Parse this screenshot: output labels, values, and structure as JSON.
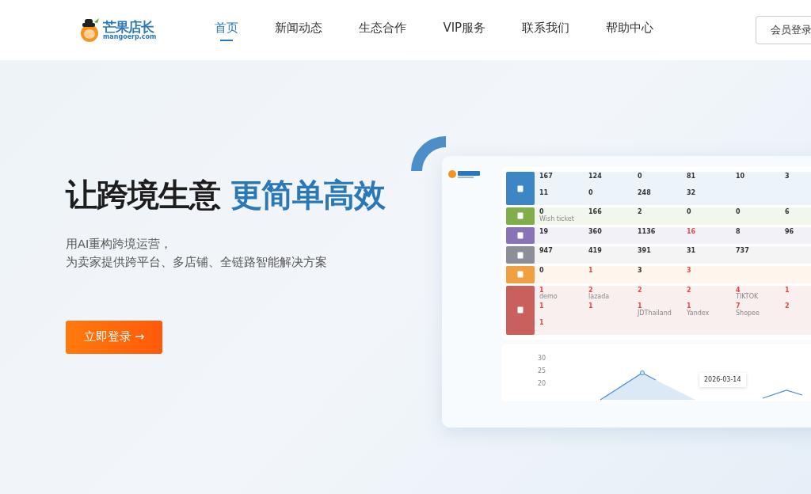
{
  "nav": {
    "logo": {
      "name": "芒果店长",
      "domain": "mangoerp.com"
    },
    "items": [
      {
        "label": "首页",
        "selected": true
      },
      {
        "label": "新闻动态",
        "selected": false
      },
      {
        "label": "生态合作",
        "selected": false
      },
      {
        "label": "VIP服务",
        "selected": false
      },
      {
        "label": "联系我们",
        "selected": false
      },
      {
        "label": "帮助中心",
        "selected": false
      }
    ],
    "login_button": "会员登录"
  },
  "hero": {
    "title": "让跨境生意",
    "title_highlight": "更简单高效",
    "subtitle": [
      "用AI重构跨境运营，",
      "为卖家提供跨平台、多店铺、全链路智能解决方案"
    ],
    "cta": "立即登录 →"
  },
  "preview": {
    "rows": [
      {
        "color": "#3d86c6",
        "cells": [
          {
            "value": "167",
            "alert": false
          },
          {
            "value": "124",
            "alert": false
          },
          {
            "value": "0",
            "alert": false
          },
          {
            "value": "81",
            "alert": false
          },
          {
            "value": "10",
            "alert": false
          },
          {
            "value": "3",
            "alert": false
          },
          {
            "value": "11",
            "alert": false
          },
          {
            "value": "0",
            "alert": false
          },
          {
            "value": "248",
            "alert": false
          },
          {
            "value": "32",
            "alert": false
          }
        ]
      },
      {
        "color": "#7fae4a",
        "cells": [
          {
            "value": "0",
            "alert": false,
            "label": "Wish ticket"
          },
          {
            "value": "166",
            "alert": false
          },
          {
            "value": "2",
            "alert": false
          },
          {
            "value": "0",
            "alert": false
          },
          {
            "value": "0",
            "alert": false
          },
          {
            "value": "6",
            "alert": false
          }
        ]
      },
      {
        "color": "#8a72b8",
        "cells": [
          {
            "value": "19",
            "alert": false
          },
          {
            "value": "360",
            "alert": false
          },
          {
            "value": "1136",
            "alert": false
          },
          {
            "value": "16",
            "alert": true
          },
          {
            "value": "8",
            "alert": false
          },
          {
            "value": "96",
            "alert": false
          }
        ]
      },
      {
        "color": "#8c8f99",
        "cells": [
          {
            "value": "947",
            "alert": false
          },
          {
            "value": "419",
            "alert": false
          },
          {
            "value": "391",
            "alert": false
          },
          {
            "value": "31",
            "alert": false
          },
          {
            "value": "737",
            "alert": false
          }
        ]
      },
      {
        "color": "#f0a040",
        "cells": [
          {
            "value": "0",
            "alert": false
          },
          {
            "value": "1",
            "alert": true
          },
          {
            "value": "3",
            "alert": false
          },
          {
            "value": "3",
            "alert": true
          }
        ]
      },
      {
        "color": "#c9605e",
        "cells": [
          {
            "value": "1",
            "alert": true,
            "label": "demo"
          },
          {
            "value": "2",
            "alert": true,
            "label": "lazada"
          },
          {
            "value": "2",
            "alert": true
          },
          {
            "value": "2",
            "alert": true
          },
          {
            "value": "4",
            "alert": true,
            "label": "TIKTOK"
          },
          {
            "value": "1",
            "alert": true
          },
          {
            "value": "1",
            "alert": true
          },
          {
            "value": "1",
            "alert": true
          },
          {
            "value": "1",
            "alert": true,
            "label": "JDThailand"
          },
          {
            "value": "1",
            "alert": true,
            "label": "Yandex"
          },
          {
            "value": "7",
            "alert": true,
            "label": "Shopee"
          },
          {
            "value": "2",
            "alert": true
          },
          {
            "value": "1",
            "alert": true
          }
        ]
      }
    ],
    "chart": {
      "yticks": [
        "30",
        "25",
        "20"
      ],
      "tooltip_date": "2026-03-14"
    }
  }
}
